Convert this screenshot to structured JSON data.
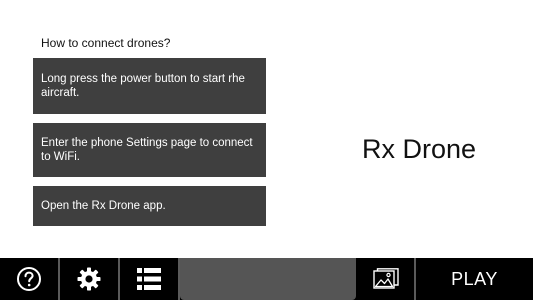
{
  "instructions": {
    "heading": "How to connect drones?",
    "steps": [
      {
        "label": "Long press the power button to start rhe aircraft."
      },
      {
        "label": "Enter the phone Settings page to connect to WiFi."
      },
      {
        "label": "Open the Rx Drone app."
      }
    ]
  },
  "brand": {
    "title": "Rx Drone"
  },
  "toolbar": {
    "help_icon": "help-icon",
    "settings_icon": "gear-icon",
    "list_icon": "list-icon",
    "gallery_icon": "gallery-icon",
    "play_label": "PLAY"
  },
  "colors": {
    "step_background": "#3f3f3f",
    "toolbar_background": "#000000",
    "center_panel": "#555555",
    "divider": "#5a5a5a"
  }
}
